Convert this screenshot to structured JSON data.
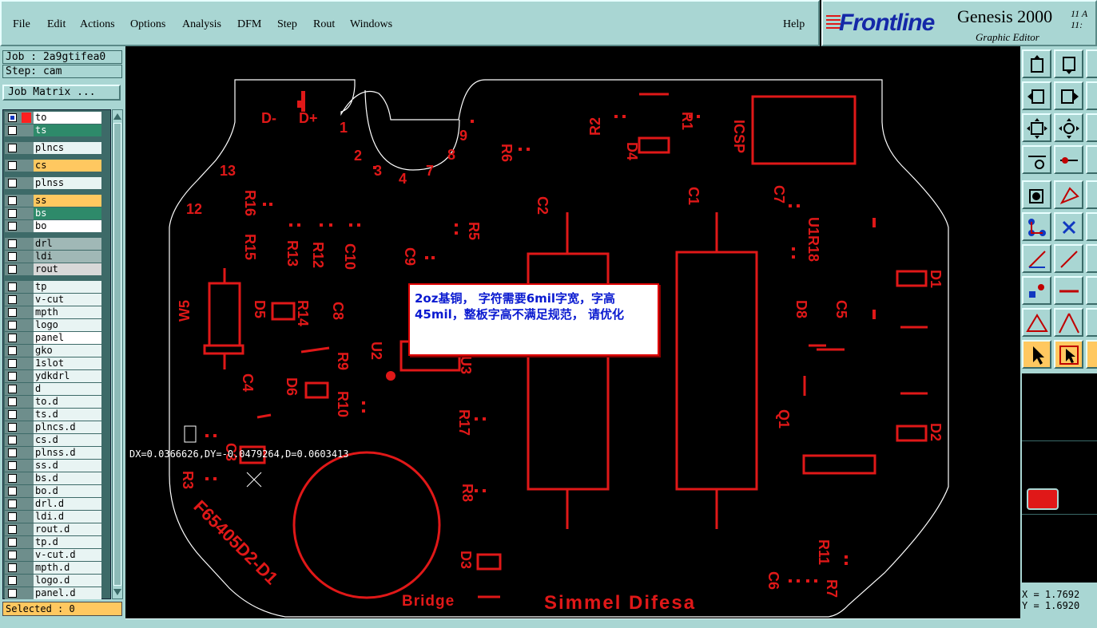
{
  "menu": [
    "File",
    "Edit",
    "Actions",
    "Options",
    "Analysis",
    "DFM",
    "Step",
    "Rout",
    "Windows"
  ],
  "help": "Help",
  "brand": {
    "logo": "Frontline",
    "title": "Genesis 2000",
    "subtitle": "Graphic Editor",
    "date_line1": "11 A",
    "date_line2": "11:"
  },
  "job": {
    "job_label": "Job : 2a9gtifea0",
    "step_label": "Step: cam",
    "matrix_button": "Job Matrix ..."
  },
  "layers": [
    "to",
    "ts",
    "plncs",
    "cs",
    "plnss",
    "ss",
    "bs",
    "bo",
    "drl",
    "ldi",
    "rout",
    "tp",
    "v-cut",
    "mpth",
    "logo",
    "panel",
    "gko",
    "1slot",
    "ydkdrl",
    "d",
    "to.d",
    "ts.d",
    "plncs.d",
    "cs.d",
    "plnss.d",
    "ss.d",
    "bs.d",
    "bo.d",
    "drl.d",
    "ldi.d",
    "rout.d",
    "tp.d",
    "v-cut.d",
    "mpth.d",
    "logo.d",
    "panel.d"
  ],
  "selected": "Selected : 0",
  "measurement": "DX=0.0366626,DY=-0.0479264,D=0.0603413",
  "note": "2oz基铜， 字符需要6mil字宽，字高45mil，整板字高不满足规范， 请优化",
  "coords": {
    "x": "X = 1.7692",
    "y": "Y = 1.6920"
  },
  "pcb": {
    "labels": [
      "D-",
      "D+",
      "1",
      "2",
      "3",
      "4",
      "7",
      "8",
      "9",
      "R2",
      "R1",
      "R6",
      "D4",
      "ICSP",
      "13",
      "12",
      "R16",
      "R15",
      "R13",
      "R12",
      "C10",
      "C9",
      "R5",
      "C2",
      "C1",
      "C7",
      "U1R18",
      "D1",
      "W5",
      "D5",
      "R14",
      "C8",
      "U2",
      "R9",
      "R10",
      "D6",
      "C4",
      "D8",
      "C5",
      "Q1",
      "D2",
      "R17",
      "R3",
      "C3",
      "R8",
      "D3",
      "R11",
      "C6",
      "R7",
      "U3"
    ],
    "part_number": "F65405D2-D1",
    "footer_left": "Bridge",
    "footer_right": "Simmel Difesa"
  },
  "colors": {
    "panel": "#a9d6d3",
    "silkscreen": "#e01818",
    "note_text": "#0a1ad0"
  }
}
